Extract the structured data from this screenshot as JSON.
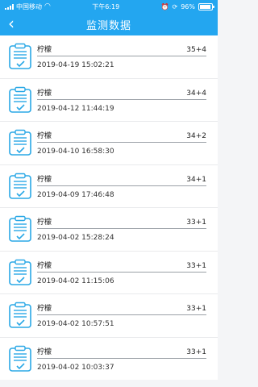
{
  "status_bar": {
    "carrier": "中国移动",
    "time": "下午6:19",
    "battery_text": "96%",
    "battery_level": 0.96
  },
  "navbar": {
    "back_glyph": "‹",
    "title": "监测数据"
  },
  "records": [
    {
      "name": "柠檬",
      "score": "35+4",
      "datetime": "2019-04-19 15:02:21"
    },
    {
      "name": "柠檬",
      "score": "34+4",
      "datetime": "2019-04-12 11:44:19"
    },
    {
      "name": "柠檬",
      "score": "34+2",
      "datetime": "2019-04-10 16:58:30"
    },
    {
      "name": "柠檬",
      "score": "34+1",
      "datetime": "2019-04-09 17:46:48"
    },
    {
      "name": "柠檬",
      "score": "33+1",
      "datetime": "2019-04-02 15:28:24"
    },
    {
      "name": "柠檬",
      "score": "33+1",
      "datetime": "2019-04-02 11:15:06"
    },
    {
      "name": "柠檬",
      "score": "33+1",
      "datetime": "2019-04-02 10:57:51"
    },
    {
      "name": "柠檬",
      "score": "33+1",
      "datetime": "2019-04-02 10:03:37"
    }
  ],
  "colors": {
    "accent": "#23a6f0",
    "icon": "#2aa8e6",
    "background": "#f4f5f7"
  }
}
